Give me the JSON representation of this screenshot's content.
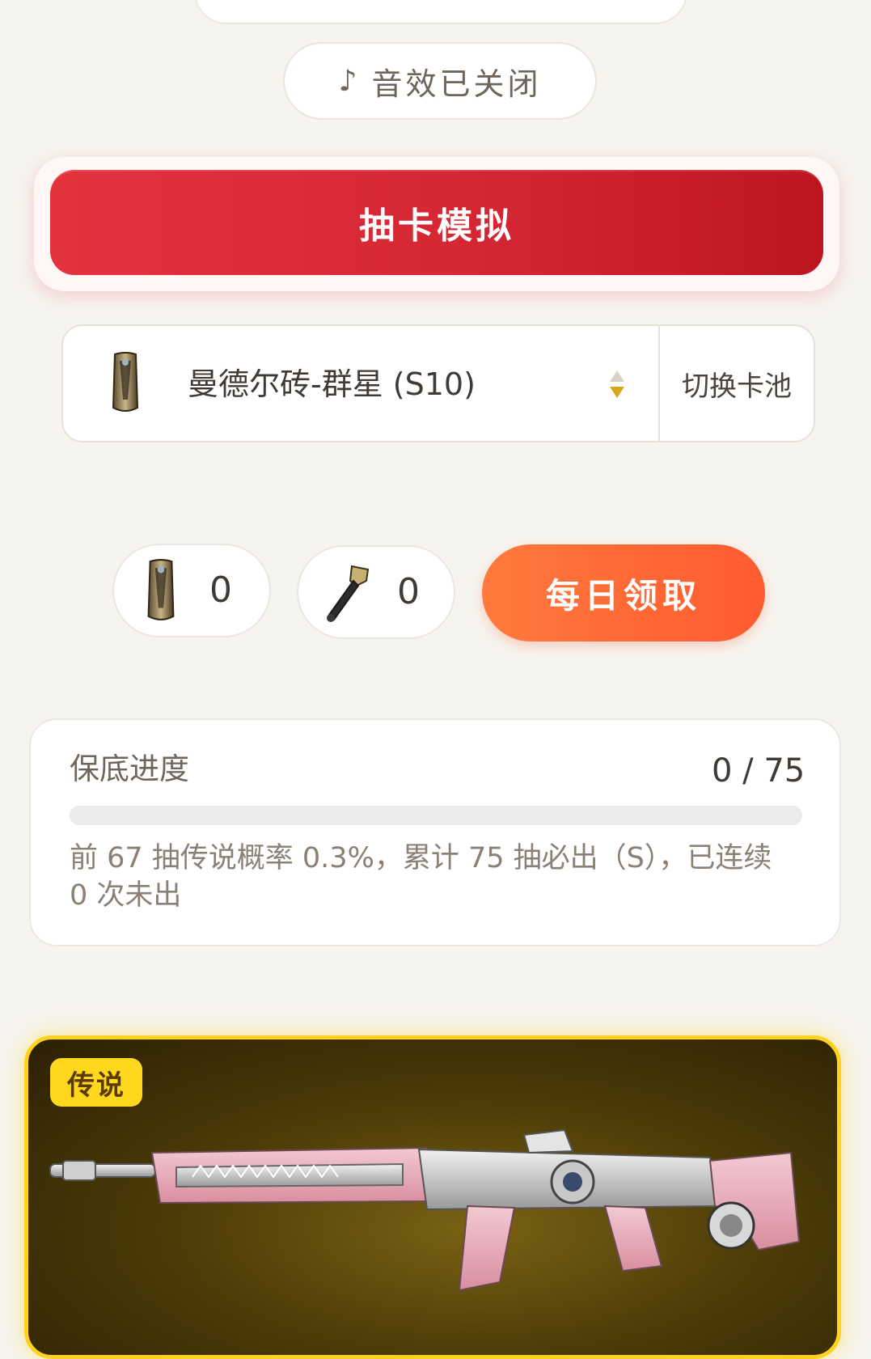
{
  "sound": {
    "icon": "music-note-icon",
    "note_glyph": "♪",
    "label": "音效已关闭"
  },
  "draw": {
    "label": "抽卡模拟"
  },
  "pool": {
    "icon": "brick-item-icon",
    "name": "曼德尔砖-群星 (S10)",
    "switch_label": "切换卡池"
  },
  "counters": [
    {
      "icon": "brick-item-icon",
      "value": "0"
    },
    {
      "icon": "key-item-icon",
      "value": "0"
    }
  ],
  "daily": {
    "label": "每日领取"
  },
  "pity": {
    "title": "保底进度",
    "count": "0 / 75",
    "progress": 0,
    "description": "前 67 抽传说概率 0.3%，累计 75 抽必出（S），已连续 0 次未出"
  },
  "featured": {
    "rarity": "传说",
    "item_icon": "pink-rifle-skin-icon"
  },
  "colors": {
    "draw_red": "#d42733",
    "claim_orange": "#ff6a35",
    "legend_gold": "#ffd21f"
  }
}
